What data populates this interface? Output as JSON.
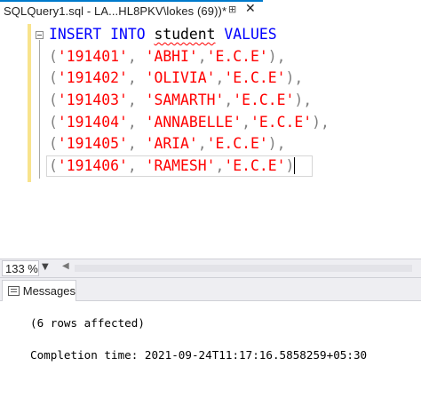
{
  "tab": {
    "title": "SQLQuery1.sql - LA...HL8PKV\\lokes (69))*",
    "pin_glyph": "⊞",
    "close_glyph": "✕"
  },
  "editor": {
    "lines": [
      [
        {
          "t": "INSERT",
          "c": "kw"
        },
        {
          "t": " ",
          "c": "id"
        },
        {
          "t": "INTO",
          "c": "kw"
        },
        {
          "t": " ",
          "c": "id"
        },
        {
          "t": "student",
          "c": "id",
          "sq": true
        },
        {
          "t": " ",
          "c": "id"
        },
        {
          "t": "VALUES",
          "c": "kw"
        }
      ],
      [
        {
          "t": "(",
          "c": "pun"
        },
        {
          "t": "'191401'",
          "c": "str"
        },
        {
          "t": ", ",
          "c": "pun"
        },
        {
          "t": "'ABHI'",
          "c": "str"
        },
        {
          "t": ",",
          "c": "pun"
        },
        {
          "t": "'E.C.E'",
          "c": "str"
        },
        {
          "t": "),",
          "c": "pun"
        }
      ],
      [
        {
          "t": "(",
          "c": "pun"
        },
        {
          "t": "'191402'",
          "c": "str"
        },
        {
          "t": ", ",
          "c": "pun"
        },
        {
          "t": "'OLIVIA'",
          "c": "str"
        },
        {
          "t": ",",
          "c": "pun"
        },
        {
          "t": "'E.C.E'",
          "c": "str"
        },
        {
          "t": "),",
          "c": "pun"
        }
      ],
      [
        {
          "t": "(",
          "c": "pun"
        },
        {
          "t": "'191403'",
          "c": "str"
        },
        {
          "t": ", ",
          "c": "pun"
        },
        {
          "t": "'SAMARTH'",
          "c": "str"
        },
        {
          "t": ",",
          "c": "pun"
        },
        {
          "t": "'E.C.E'",
          "c": "str"
        },
        {
          "t": "),",
          "c": "pun"
        }
      ],
      [
        {
          "t": "(",
          "c": "pun"
        },
        {
          "t": "'191404'",
          "c": "str"
        },
        {
          "t": ", ",
          "c": "pun"
        },
        {
          "t": "'ANNABELLE'",
          "c": "str"
        },
        {
          "t": ",",
          "c": "pun"
        },
        {
          "t": "'E.C.E'",
          "c": "str"
        },
        {
          "t": "),",
          "c": "pun"
        }
      ],
      [
        {
          "t": "(",
          "c": "pun"
        },
        {
          "t": "'191405'",
          "c": "str"
        },
        {
          "t": ", ",
          "c": "pun"
        },
        {
          "t": "'ARIA'",
          "c": "str"
        },
        {
          "t": ",",
          "c": "pun"
        },
        {
          "t": "'E.C.E'",
          "c": "str"
        },
        {
          "t": "),",
          "c": "pun"
        }
      ],
      [
        {
          "t": "(",
          "c": "pun"
        },
        {
          "t": "'191406'",
          "c": "str"
        },
        {
          "t": ", ",
          "c": "pun"
        },
        {
          "t": "'RAMESH'",
          "c": "str"
        },
        {
          "t": ",",
          "c": "pun"
        },
        {
          "t": "'E.C.E'",
          "c": "str"
        },
        {
          "t": ")",
          "c": "pun"
        }
      ]
    ]
  },
  "status": {
    "zoom": "133 %",
    "zoom_arrow": "▼",
    "scroll_left": "◀"
  },
  "results": {
    "tab_label": "Messages",
    "rows_affected": "(6 rows affected)",
    "completion": "Completion time: 2021-09-24T11:17:16.5858259+05:30"
  },
  "colors": {
    "keyword": "#0000ff",
    "string": "#ff0000",
    "punctuation": "#808080",
    "active_tab_accent": "#007acc"
  }
}
